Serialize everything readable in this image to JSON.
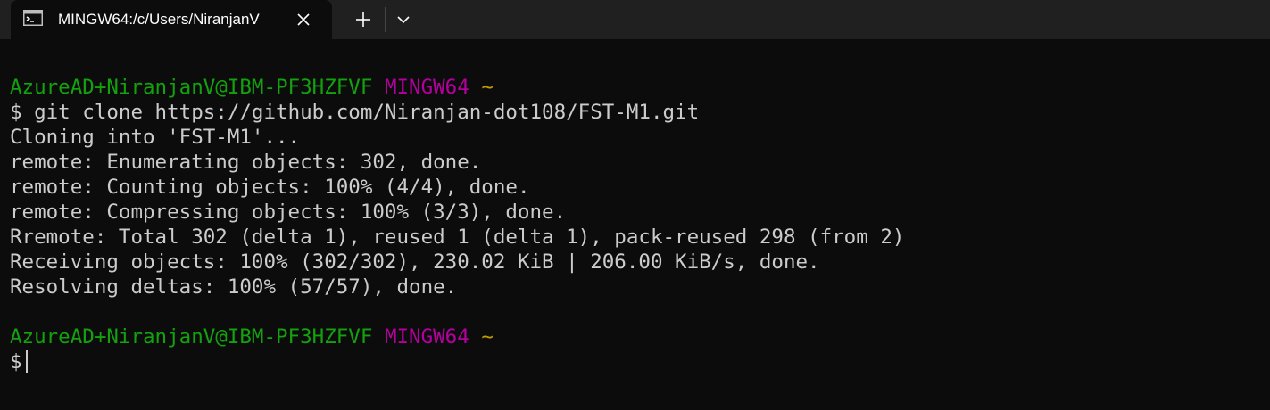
{
  "tab": {
    "title": "MINGW64:/c/Users/NiranjanV"
  },
  "colors": {
    "background": "#0c0c0c",
    "tabbar": "#202020",
    "text": "#cccccc",
    "user_host": "#13a10e",
    "shell_name": "#b4009e",
    "path": "#c19c00"
  },
  "icons": {
    "tab": "terminal-icon",
    "close": "close-icon",
    "new_tab": "plus-icon",
    "dropdown": "chevron-down-icon"
  },
  "terminal": {
    "prompt1": {
      "user_host": "AzureAD+NiranjanV@IBM-PF3HZFVF",
      "shell": "MINGW64",
      "path": "~"
    },
    "command_prompt": "$",
    "command": "git clone https://github.com/Niranjan-dot108/FST-M1.git",
    "output": [
      "Cloning into 'FST-M1'...",
      "remote: Enumerating objects: 302, done.",
      "remote: Counting objects: 100% (4/4), done.",
      "remote: Compressing objects: 100% (3/3), done.",
      "Rremote: Total 302 (delta 1), reused 1 (delta 1), pack-reused 298 (from 2)",
      "Receiving objects: 100% (302/302), 230.02 KiB | 206.00 KiB/s, done.",
      "Resolving deltas: 100% (57/57), done."
    ],
    "prompt2": {
      "user_host": "AzureAD+NiranjanV@IBM-PF3HZFVF",
      "shell": "MINGW64",
      "path": "~"
    },
    "final_prompt": "$"
  }
}
